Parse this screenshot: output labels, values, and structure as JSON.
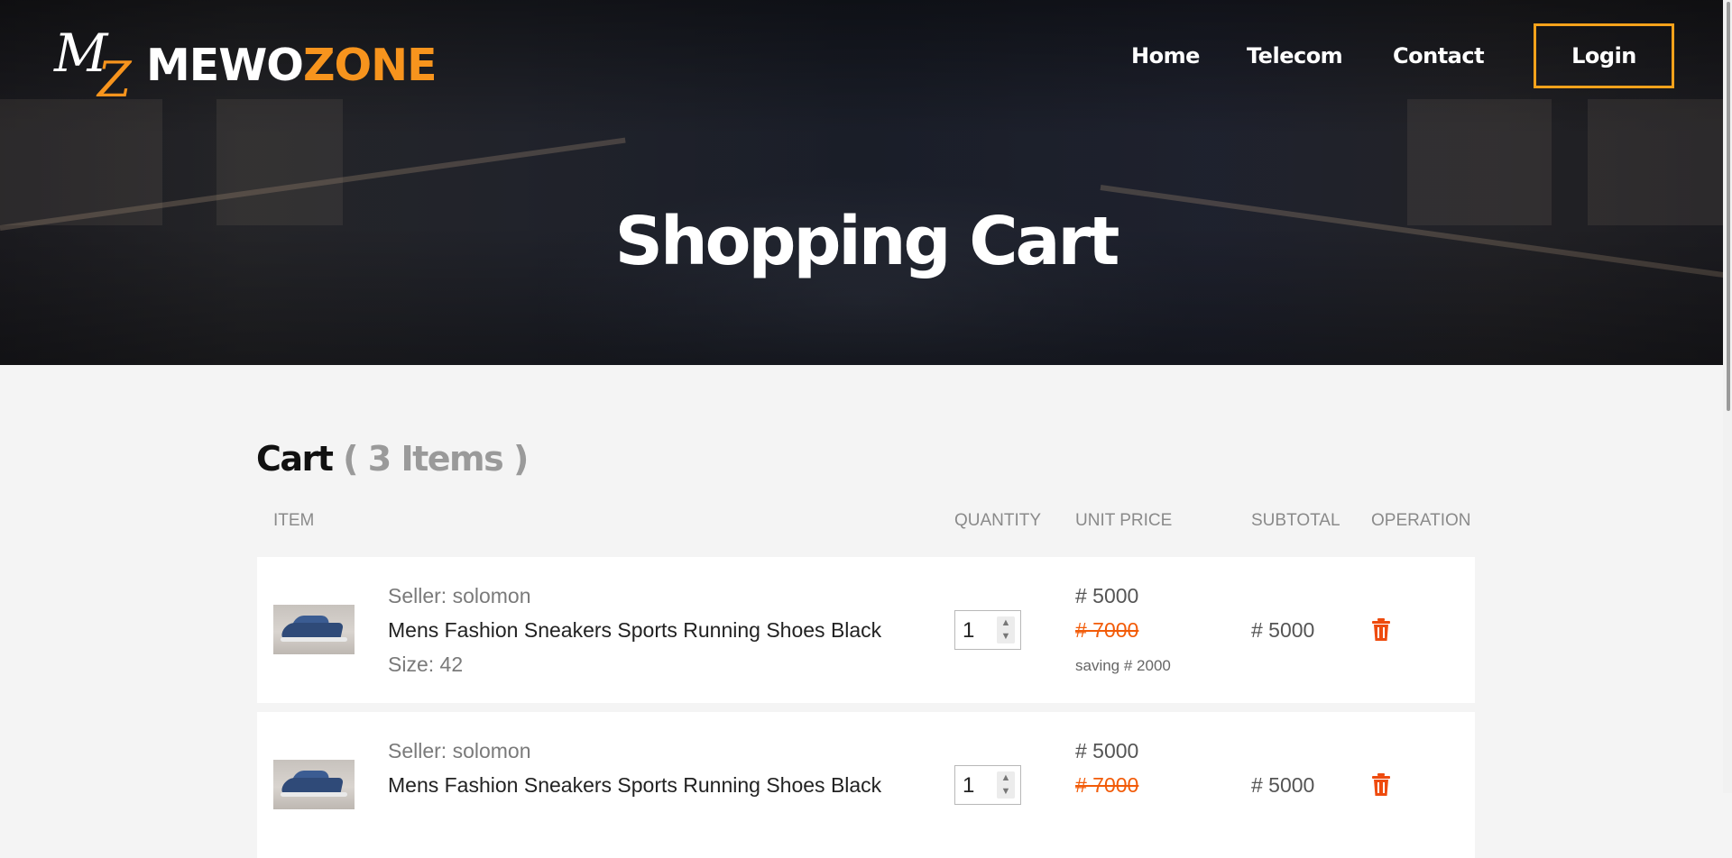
{
  "brand": {
    "logo_m": "M",
    "logo_z": "Z",
    "name_white": "MEWO",
    "name_orange": "ZONE"
  },
  "nav": {
    "home": "Home",
    "telecom": "Telecom",
    "contact": "Contact",
    "login": "Login"
  },
  "hero": {
    "title": "Shopping Cart"
  },
  "cart": {
    "heading": "Cart",
    "count": "( 3 Items )",
    "columns": {
      "item": "ITEM",
      "quantity": "QUANTITY",
      "unit_price": "UNIT PRICE",
      "subtotal": "SUBTOTAL",
      "operation": "OPERATION"
    },
    "items": [
      {
        "seller": "Seller: solomon",
        "name": "Mens Fashion Sneakers Sports Running Shoes Black",
        "size": "Size: 42",
        "quantity": "1",
        "price": "# 5000",
        "old_price": "# 7000",
        "saving": "saving # 2000",
        "subtotal": "# 5000"
      },
      {
        "seller": "Seller: solomon",
        "name": "Mens Fashion Sneakers Sports Running Shoes Black",
        "size": "",
        "quantity": "1",
        "price": "# 5000",
        "old_price": "# 7000",
        "saving": "",
        "subtotal": "# 5000"
      }
    ]
  },
  "colors": {
    "accent": "#f7941d",
    "strike": "#f25b08",
    "trash": "#ee4b0e"
  },
  "icons": {
    "delete": "trash-icon",
    "spinner": "chevron-up-down-icon",
    "product": "sneaker-thumbnail"
  }
}
